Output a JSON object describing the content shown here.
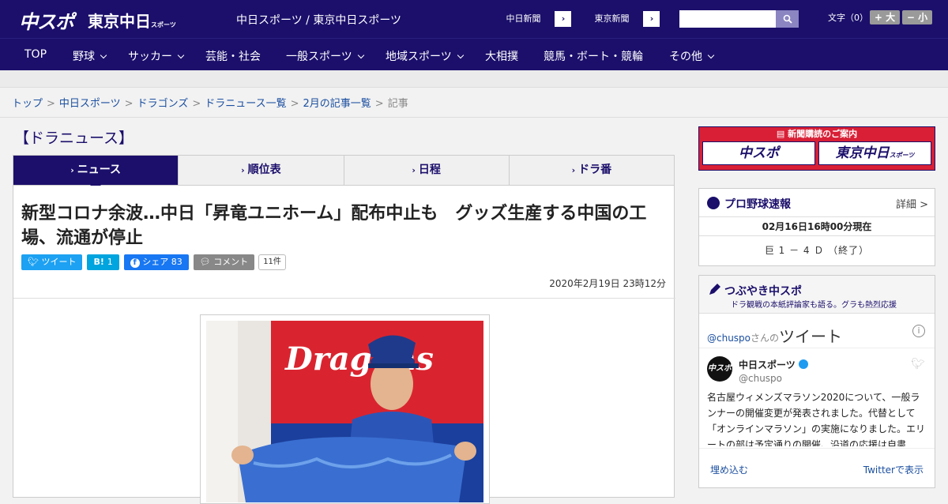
{
  "header": {
    "logo_chuspo": "中スポ",
    "logo_tokyo": "東京中日",
    "logo_tokyo_small": "スポーツ",
    "site_title": "中日スポーツ / 東京中日スポーツ",
    "paper_links": [
      "中日新聞",
      "東京新聞"
    ],
    "search_placeholder": "",
    "font_size_label": "文字（0）",
    "font_plus": "+ 大",
    "font_minus": "− 小"
  },
  "nav": {
    "items": [
      {
        "label": "TOP",
        "has_menu": false
      },
      {
        "label": "野球",
        "has_menu": true
      },
      {
        "label": "サッカー",
        "has_menu": true
      },
      {
        "label": "芸能・社会",
        "has_menu": false
      },
      {
        "label": "一般スポーツ",
        "has_menu": true
      },
      {
        "label": "地域スポーツ",
        "has_menu": true
      },
      {
        "label": "大相撲",
        "has_menu": false
      },
      {
        "label": "競馬・ボート・競輪",
        "has_menu": false
      },
      {
        "label": "その他",
        "has_menu": true
      }
    ]
  },
  "breadcrumb": {
    "items": [
      "トップ",
      "中日スポーツ",
      "ドラゴンズ",
      "ドラニュース一覧",
      "2月の記事一覧"
    ],
    "current": "記事"
  },
  "section_title": "【ドラニュース】",
  "tabs": [
    {
      "label": "ニュース",
      "active": true
    },
    {
      "label": "順位表",
      "active": false
    },
    {
      "label": "日程",
      "active": false
    },
    {
      "label": "ドラ番",
      "active": false
    }
  ],
  "article": {
    "headline": "新型コロナ余波…中日「昇竜ユニホーム」配布中止も　グッズ生産する中国の工場、流通が停止",
    "share": {
      "tweet": "ツイート",
      "hatena_label": "B!",
      "hatena_count": "1",
      "facebook": "シェア",
      "facebook_count": "83",
      "comment": "コメント",
      "comment_count": "11件"
    },
    "date": "2020年2月19日 23時12分",
    "photo_text": "Dragons"
  },
  "sidebar": {
    "subscription_caption": "新聞購読のご案内",
    "subscription_logos": [
      "中スポ",
      "東京中日"
    ],
    "subscription_small": "スポーツ",
    "baseball": {
      "title": "プロ野球速報",
      "more": "詳細 >",
      "time": "02月16日16時00分現在",
      "game": "巨 1 － 4 Ｄ （終了）"
    },
    "tweets": {
      "title": "つぶやき中スポ",
      "subtitle": "ドラ観戦の本紙評論家も語る。グラも熱烈応援",
      "handle": "@chuspo",
      "handle_suffix": "さんの",
      "heading": "ツイート",
      "user_name": "中日スポーツ",
      "user_handle": "@chuspo",
      "avatar_text": "中スポ",
      "text": "名古屋ウィメンズマラソン2020について、一般ランナーの開催変更が発表されました。代替として「オンラインマラソン」の実施になりました。エリートの部は予定通りの開催、沿道の応援は自粛",
      "embed": "埋め込む",
      "view": "Twitterで表示"
    }
  },
  "colors": {
    "brand": "#1b0f6b",
    "twitter": "#1da1f2",
    "hatena": "#00a4de",
    "facebook": "#1877f2",
    "comment": "#888888",
    "subscription": "#d81f36"
  }
}
